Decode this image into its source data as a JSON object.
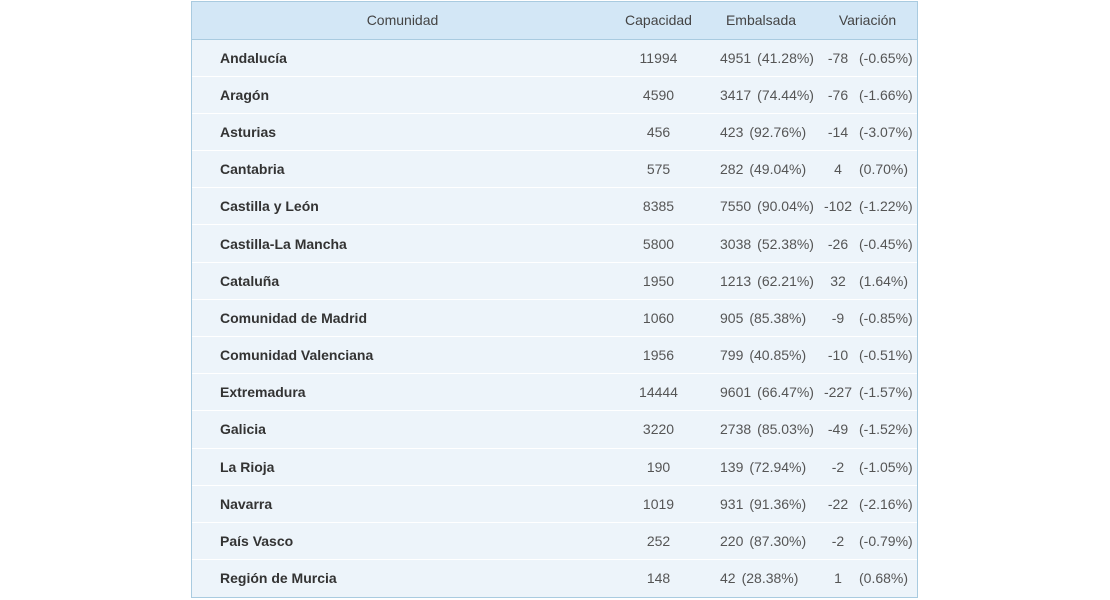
{
  "table": {
    "headers": {
      "comunidad": "Comunidad",
      "capacidad": "Capacidad",
      "embalsada": "Embalsada",
      "variacion": "Variación"
    },
    "rows": [
      {
        "comunidad": "Andalucía",
        "capacidad": "11994",
        "embalsada": "4951",
        "embalsada_pct": "(41.28%)",
        "variacion": "-78",
        "variacion_pct": "(-0.65%)"
      },
      {
        "comunidad": "Aragón",
        "capacidad": "4590",
        "embalsada": "3417",
        "embalsada_pct": "(74.44%)",
        "variacion": "-76",
        "variacion_pct": "(-1.66%)"
      },
      {
        "comunidad": "Asturias",
        "capacidad": "456",
        "embalsada": "423",
        "embalsada_pct": "(92.76%)",
        "variacion": "-14",
        "variacion_pct": "(-3.07%)"
      },
      {
        "comunidad": "Cantabria",
        "capacidad": "575",
        "embalsada": "282",
        "embalsada_pct": "(49.04%)",
        "variacion": "4",
        "variacion_pct": "(0.70%)"
      },
      {
        "comunidad": "Castilla y León",
        "capacidad": "8385",
        "embalsada": "7550",
        "embalsada_pct": "(90.04%)",
        "variacion": "-102",
        "variacion_pct": "(-1.22%)"
      },
      {
        "comunidad": "Castilla-La Mancha",
        "capacidad": "5800",
        "embalsada": "3038",
        "embalsada_pct": "(52.38%)",
        "variacion": "-26",
        "variacion_pct": "(-0.45%)"
      },
      {
        "comunidad": "Cataluña",
        "capacidad": "1950",
        "embalsada": "1213",
        "embalsada_pct": "(62.21%)",
        "variacion": "32",
        "variacion_pct": "(1.64%)"
      },
      {
        "comunidad": "Comunidad de Madrid",
        "capacidad": "1060",
        "embalsada": "905",
        "embalsada_pct": "(85.38%)",
        "variacion": "-9",
        "variacion_pct": "(-0.85%)"
      },
      {
        "comunidad": "Comunidad Valenciana",
        "capacidad": "1956",
        "embalsada": "799",
        "embalsada_pct": "(40.85%)",
        "variacion": "-10",
        "variacion_pct": "(-0.51%)"
      },
      {
        "comunidad": "Extremadura",
        "capacidad": "14444",
        "embalsada": "9601",
        "embalsada_pct": "(66.47%)",
        "variacion": "-227",
        "variacion_pct": "(-1.57%)"
      },
      {
        "comunidad": "Galicia",
        "capacidad": "3220",
        "embalsada": "2738",
        "embalsada_pct": "(85.03%)",
        "variacion": "-49",
        "variacion_pct": "(-1.52%)"
      },
      {
        "comunidad": "La Rioja",
        "capacidad": "190",
        "embalsada": "139",
        "embalsada_pct": "(72.94%)",
        "variacion": "-2",
        "variacion_pct": "(-1.05%)"
      },
      {
        "comunidad": "Navarra",
        "capacidad": "1019",
        "embalsada": "931",
        "embalsada_pct": "(91.36%)",
        "variacion": "-22",
        "variacion_pct": "(-2.16%)"
      },
      {
        "comunidad": "País Vasco",
        "capacidad": "252",
        "embalsada": "220",
        "embalsada_pct": "(87.30%)",
        "variacion": "-2",
        "variacion_pct": "(-0.79%)"
      },
      {
        "comunidad": "Región de Murcia",
        "capacidad": "148",
        "embalsada": "42",
        "embalsada_pct": "(28.38%)",
        "variacion": "1",
        "variacion_pct": "(0.68%)"
      }
    ]
  },
  "colors": {
    "header_bg": "#d3e7f6",
    "body_bg": "#edf4fa",
    "border": "#a9cbe0"
  }
}
